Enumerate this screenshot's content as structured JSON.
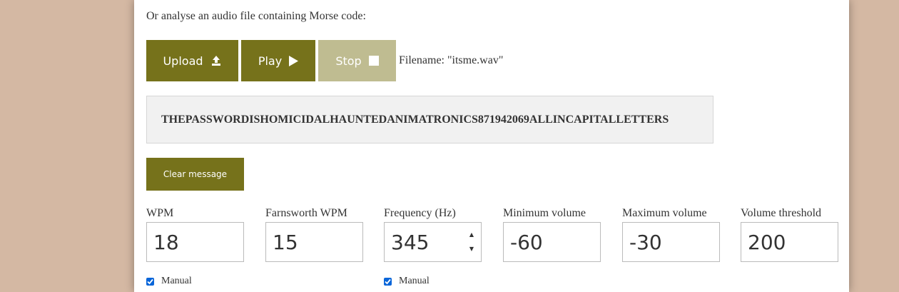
{
  "intro_text": "Or analyse an audio file containing Morse code:",
  "buttons": {
    "upload": "Upload",
    "play": "Play",
    "stop": "Stop",
    "clear": "Clear message"
  },
  "filename_text": "Filename: \"itsme.wav\"",
  "message": "THEPASSWORDISHOMICIDALHAUNTEDANIMATRONICS871942069ALLINCAPITALLETTERS",
  "fields": [
    {
      "label": "WPM",
      "value": "18"
    },
    {
      "label": "Farnsworth WPM",
      "value": "15"
    },
    {
      "label": "Frequency (Hz)",
      "value": "345"
    },
    {
      "label": "Minimum volume",
      "value": "-60"
    },
    {
      "label": "Maximum volume",
      "value": "-30"
    },
    {
      "label": "Volume threshold",
      "value": "200"
    }
  ],
  "checkboxes": [
    {
      "label": "Manual",
      "checked": true
    },
    {
      "label": "Manual",
      "checked": true
    }
  ],
  "colors": {
    "accent": "#76721b",
    "accent_disabled": "#bfbc91",
    "background": "#d4b8a3"
  },
  "icons": {
    "upload": "upload-icon",
    "play": "play-icon",
    "stop": "stop-icon",
    "checkbox": "checkmark-icon"
  }
}
